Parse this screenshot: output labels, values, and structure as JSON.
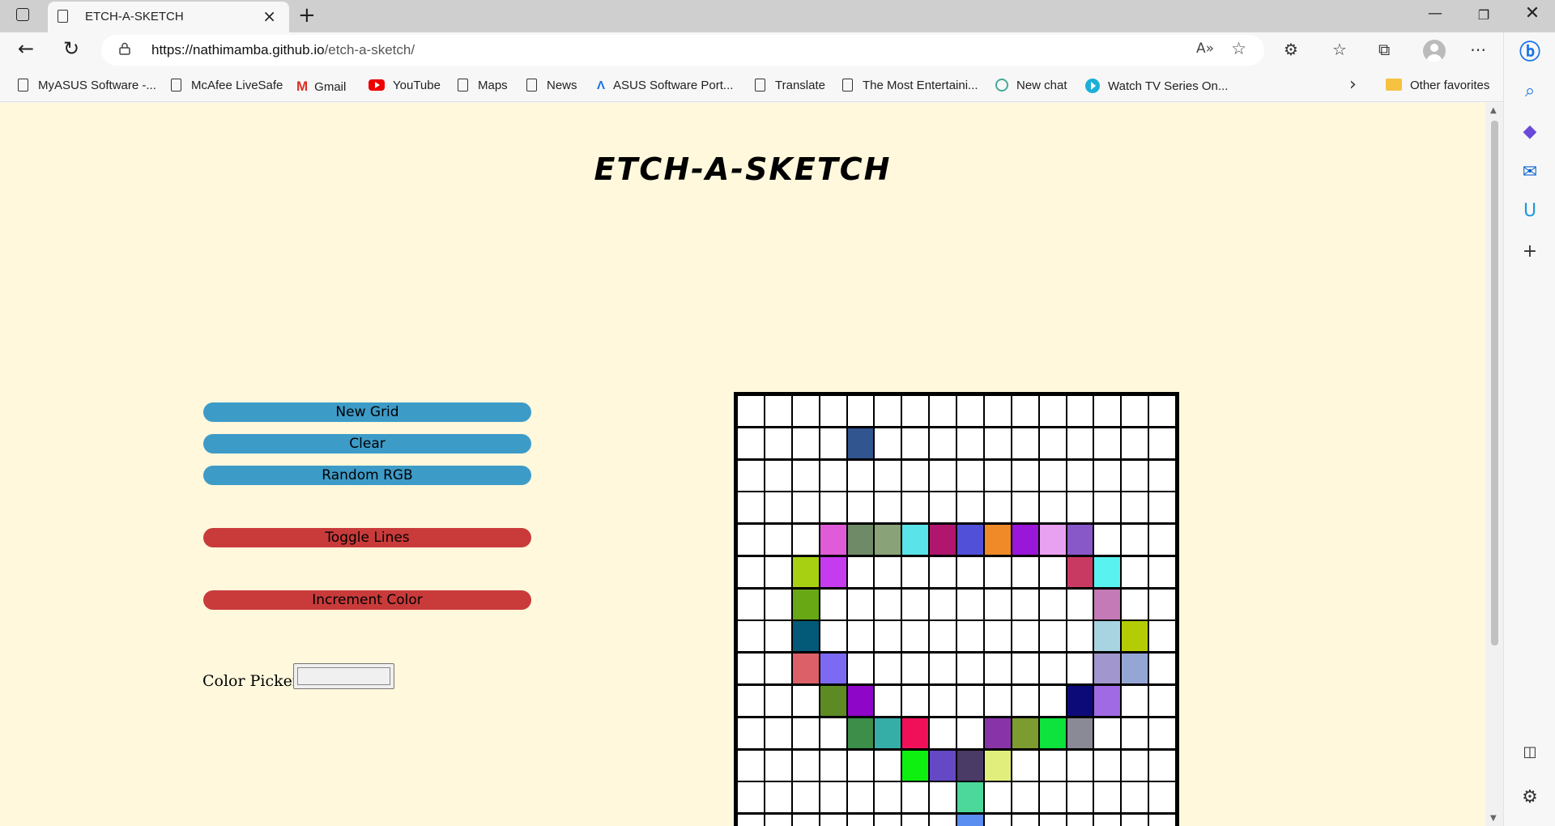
{
  "browser": {
    "tab_title": "ETCH-A-SKETCH",
    "url_domain": "https://nathimamba.github.io",
    "url_path": "/etch-a-sketch/",
    "bookmarks": [
      {
        "label": "MyASUS Software -...",
        "icon": "page-icon"
      },
      {
        "label": "McAfee LiveSafe",
        "icon": "page-icon"
      },
      {
        "label": "Gmail",
        "icon": "gmail-icon"
      },
      {
        "label": "YouTube",
        "icon": "youtube-icon"
      },
      {
        "label": "Maps",
        "icon": "page-icon"
      },
      {
        "label": "News",
        "icon": "page-icon"
      },
      {
        "label": "ASUS Software Port...",
        "icon": "asus-icon"
      },
      {
        "label": "Translate",
        "icon": "page-icon"
      },
      {
        "label": "The Most Entertaini...",
        "icon": "page-icon"
      },
      {
        "label": "New chat",
        "icon": "chatgpt-icon"
      },
      {
        "label": "Watch TV Series On...",
        "icon": "play-icon"
      }
    ],
    "other_favorites": "Other favorites"
  },
  "page": {
    "heading": "ETCH-A-SKETCH",
    "buttons": {
      "new_grid": "New Grid",
      "clear": "Clear",
      "random_rgb": "Random RGB",
      "toggle_lines": "Toggle Lines",
      "increment_color": "Increment Color"
    },
    "color_picker_label": "Color Picker:"
  },
  "grid": {
    "columns": 16,
    "visible_rows": 14,
    "colored_cells": [
      {
        "row": 1,
        "col": 4,
        "color": "#31558f"
      },
      {
        "row": 4,
        "col": 3,
        "color": "#e05bd7"
      },
      {
        "row": 4,
        "col": 4,
        "color": "#6e8a66"
      },
      {
        "row": 4,
        "col": 5,
        "color": "#8aa277"
      },
      {
        "row": 4,
        "col": 6,
        "color": "#5ae3e8"
      },
      {
        "row": 4,
        "col": 7,
        "color": "#b0166d"
      },
      {
        "row": 4,
        "col": 8,
        "color": "#5050d8"
      },
      {
        "row": 4,
        "col": 9,
        "color": "#f08a28"
      },
      {
        "row": 4,
        "col": 10,
        "color": "#9a16d8"
      },
      {
        "row": 4,
        "col": 11,
        "color": "#e8a0f0"
      },
      {
        "row": 4,
        "col": 12,
        "color": "#8858c8"
      },
      {
        "row": 5,
        "col": 2,
        "color": "#a8d012"
      },
      {
        "row": 5,
        "col": 3,
        "color": "#c63af0"
      },
      {
        "row": 5,
        "col": 12,
        "color": "#c83a62"
      },
      {
        "row": 5,
        "col": 13,
        "color": "#5af2f0"
      },
      {
        "row": 6,
        "col": 2,
        "color": "#68a814"
      },
      {
        "row": 6,
        "col": 13,
        "color": "#c47ab6"
      },
      {
        "row": 7,
        "col": 2,
        "color": "#035a78"
      },
      {
        "row": 7,
        "col": 13,
        "color": "#a8d4e2"
      },
      {
        "row": 7,
        "col": 14,
        "color": "#b4cc06"
      },
      {
        "row": 8,
        "col": 2,
        "color": "#dc6068"
      },
      {
        "row": 8,
        "col": 3,
        "color": "#7c6af5"
      },
      {
        "row": 8,
        "col": 13,
        "color": "#a196ce"
      },
      {
        "row": 8,
        "col": 14,
        "color": "#94a6d4"
      },
      {
        "row": 9,
        "col": 3,
        "color": "#5e8a24"
      },
      {
        "row": 9,
        "col": 4,
        "color": "#8e06c8"
      },
      {
        "row": 9,
        "col": 12,
        "color": "#0c0a78"
      },
      {
        "row": 9,
        "col": 13,
        "color": "#a06ae4"
      },
      {
        "row": 10,
        "col": 4,
        "color": "#3c8e48"
      },
      {
        "row": 10,
        "col": 5,
        "color": "#36aea8"
      },
      {
        "row": 10,
        "col": 6,
        "color": "#f0105a"
      },
      {
        "row": 10,
        "col": 9,
        "color": "#8834a8"
      },
      {
        "row": 10,
        "col": 10,
        "color": "#7c9c30"
      },
      {
        "row": 10,
        "col": 11,
        "color": "#0ee23c"
      },
      {
        "row": 10,
        "col": 12,
        "color": "#8a8a96"
      },
      {
        "row": 11,
        "col": 6,
        "color": "#0ef010"
      },
      {
        "row": 11,
        "col": 7,
        "color": "#6448c4"
      },
      {
        "row": 11,
        "col": 8,
        "color": "#4a3a66"
      },
      {
        "row": 11,
        "col": 9,
        "color": "#e2ee7c"
      },
      {
        "row": 12,
        "col": 8,
        "color": "#4cd89a"
      },
      {
        "row": 13,
        "col": 8,
        "color": "#5a8ef0"
      }
    ]
  },
  "colors": {
    "page_background": "#fff8dc",
    "button_blue": "#3d9bc8",
    "button_red": "#c93b3b"
  }
}
